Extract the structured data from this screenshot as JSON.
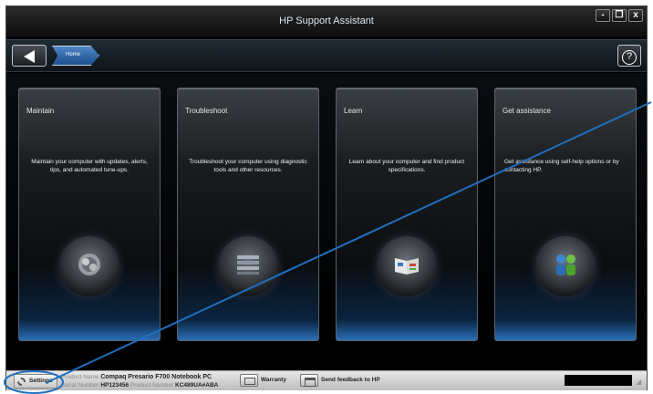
{
  "window": {
    "title": "HP Support Assistant",
    "controls": [
      "-",
      "❐",
      "x"
    ]
  },
  "nav": {
    "breadcrumb": "Home",
    "help_symbol": "?"
  },
  "cards": [
    {
      "title": "Maintain",
      "description": "Maintain your computer with updates, alerts, tips, and automated tune-ups.",
      "icon": "gears-icon"
    },
    {
      "title": "Troubleshoot",
      "description": "Troubleshoot your computer using diagnostic tools and other resources.",
      "icon": "diagnostic-tools-icon"
    },
    {
      "title": "Learn",
      "description": "Learn about your computer and find product specifications.",
      "icon": "book-icon"
    },
    {
      "title": "Get assistance",
      "description": "Get assistance using self-help options or by contacting HP.",
      "icon": "people-icon"
    }
  ],
  "footer": {
    "settings_label": "Settings",
    "product_name_label": "Product Name",
    "product_name": "Compaq Presario F700 Notebook PC",
    "serial_number_label": "Serial Number",
    "serial_number": "HP123456",
    "product_number_label": "Product Number",
    "product_number": "KC489UA#ABA",
    "warranty_label": "Warranty",
    "feedback_label": "Send feedback to HP"
  },
  "colors": {
    "accent_blue": "#2a6fb6",
    "annotation": "#1f6fbf"
  }
}
